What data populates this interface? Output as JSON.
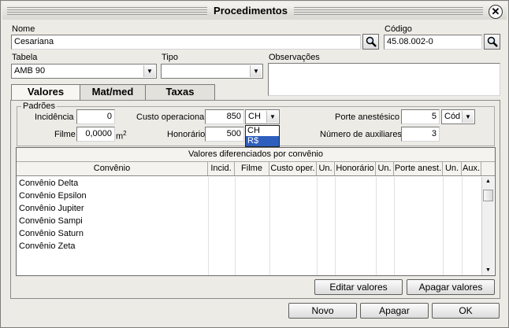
{
  "window": {
    "title": "Procedimentos"
  },
  "fields": {
    "nome": {
      "label": "Nome",
      "value": "Cesariana"
    },
    "codigo": {
      "label": "Código",
      "value": "45.08.002-0"
    },
    "tabela": {
      "label": "Tabela",
      "value": "AMB 90"
    },
    "tipo": {
      "label": "Tipo",
      "value": ""
    },
    "observacoes": {
      "label": "Observações",
      "value": ""
    }
  },
  "tabs": [
    {
      "label": "Valores",
      "active": true
    },
    {
      "label": "Mat/med",
      "active": false
    },
    {
      "label": "Taxas",
      "active": false
    }
  ],
  "padroes": {
    "title": "Padrões",
    "incidencia": {
      "label": "Incidência",
      "value": "0"
    },
    "filme": {
      "label": "Filme",
      "value": "0,0000",
      "unit": "m",
      "unit_sup": "2"
    },
    "custo_operacional": {
      "label": "Custo operacional",
      "value": "850",
      "unit": "CH"
    },
    "unit_options": [
      "CH",
      "R$"
    ],
    "unit_highlighted": "R$",
    "honorario": {
      "label": "Honorário",
      "value": "500"
    },
    "porte_anestesico": {
      "label": "Porte anestésico",
      "value": "5",
      "unit": "Cód"
    },
    "numero_auxiliares": {
      "label": "Número de auxiliares",
      "value": "3"
    }
  },
  "grid": {
    "title": "Valores diferenciados por convênio",
    "columns": [
      "Convênio",
      "Incid.",
      "Filme",
      "Custo oper.",
      "Un.",
      "Honorário",
      "Un.",
      "Porte anest.",
      "Un.",
      "Aux."
    ],
    "rows": [
      "Convênio Delta",
      "Convênio Epsilon",
      "Convênio Jupiter",
      "Convênio Sampi",
      "Convênio Saturn",
      "Convênio Zeta"
    ]
  },
  "buttons": {
    "editar_valores": "Editar valores",
    "apagar_valores": "Apagar valores",
    "novo": "Novo",
    "apagar": "Apagar",
    "ok": "OK"
  },
  "icons": {
    "search": "search-icon",
    "close": "close-icon",
    "dropdown": "chevron-down-icon"
  }
}
